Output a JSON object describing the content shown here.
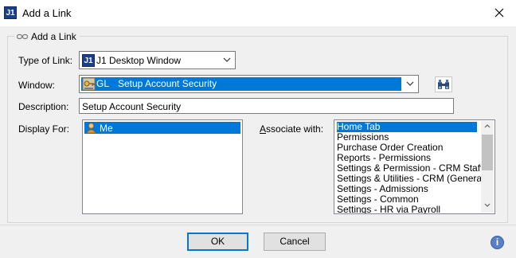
{
  "window": {
    "title": "Add a Link",
    "app_icon_text": "J1",
    "close_icon": "close-icon"
  },
  "group": {
    "legend": "Add a Link",
    "legend_icon": "link-icon"
  },
  "type_of_link": {
    "label": "Type of Link:",
    "value": "J1 Desktop Window",
    "icon_text": "J1"
  },
  "window_field": {
    "label": "Window:",
    "module": "GL",
    "value": "Setup Account Security",
    "icon": "security-icon",
    "find_icon": "binoculars-icon"
  },
  "description": {
    "label": "Description:",
    "value": "Setup Account Security"
  },
  "display_for": {
    "label": "Display For:",
    "items": [
      "Me"
    ],
    "selected_index": 0,
    "item_icon": "user-icon"
  },
  "associate_with": {
    "label": "Associate with:",
    "items": [
      "Home Tab",
      "Permissions",
      "Purchase Order Creation",
      "Reports - Permissions",
      "Settings & Permission - CRM Staff",
      "Settings & Utilities - CRM (General)",
      "Settings - Admissions",
      "Settings - Common",
      "Settings - HR via Payroll"
    ],
    "selected_index": 0
  },
  "buttons": {
    "ok": "OK",
    "cancel": "Cancel",
    "help_icon": "help-icon",
    "help_text": "i"
  },
  "colors": {
    "selection": "#0078d7",
    "dialog_bg": "#f0f0f0",
    "default_button_border": "#0078d7"
  }
}
